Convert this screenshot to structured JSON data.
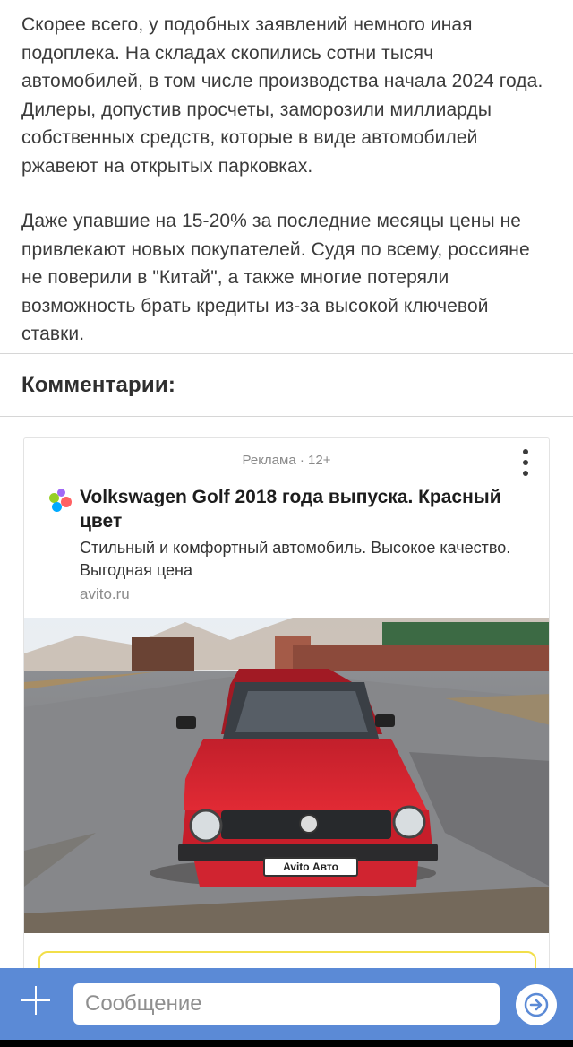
{
  "article": {
    "paragraphs": [
      "Скорее всего, у подобных заявлений немного иная подоплека. На складах скопились сотни тысяч автомобилей, в том числе производства начала 2024 года. Дилеры, допустив просчеты, заморозили миллиарды собственных средств, которые в виде автомобилей ржавеют на открытых парковках.",
      "Даже упавшие на 15-20% за последние месяцы цены не привлекают новых покупателей. Судя по всему, россияне не поверили в \"Китай\", а также многие потеряли возможность брать кредиты из-за высокой ключевой ставки."
    ]
  },
  "comments": {
    "title": "Комментарии:"
  },
  "ad": {
    "label": "Реклама · 12+",
    "title": "Volkswagen Golf 2018 года выпуска. Красный цвет",
    "description": "Стильный и комфортный автомобиль. Высокое качество. Выгодная цена",
    "domain": "avito.ru",
    "plate_text": "Avito Авто",
    "logo_colors": [
      "#97cf26",
      "#a169f7",
      "#ff6163",
      "#00aaff"
    ]
  },
  "composer": {
    "placeholder": "Сообщение"
  },
  "colors": {
    "bar": "#5b8ad6",
    "send_arrow": "#5b8ad6"
  }
}
